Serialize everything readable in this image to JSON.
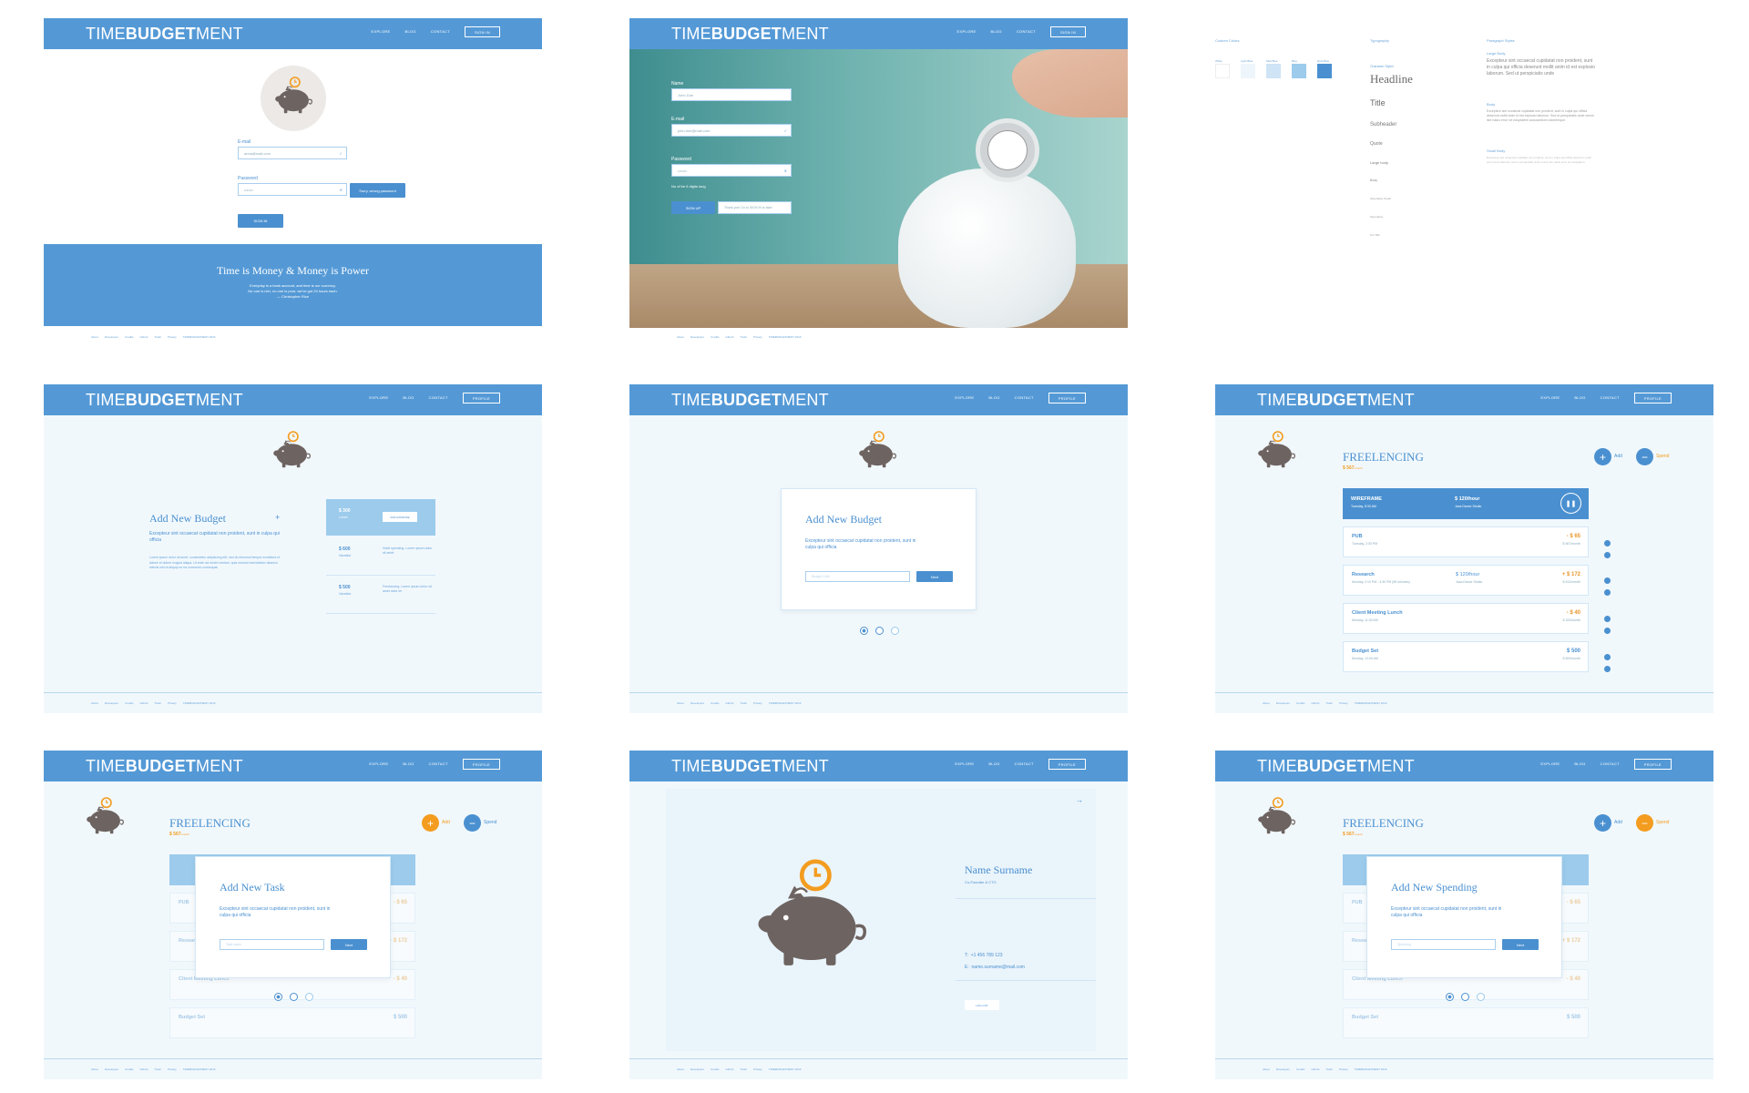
{
  "brand": {
    "pre": "TIME",
    "mid": "BUDGET",
    "post": "MENT"
  },
  "nav": {
    "explore": "EXPLORE",
    "blog": "BLOG",
    "contact": "CONTACT",
    "signin": "SIGN IN",
    "profile": "PROFILE"
  },
  "footer": [
    "About",
    "Developers",
    "Credits",
    "Github",
    "Trash",
    "Privacy",
    "TIMEBUDGETMENT 2016"
  ],
  "s1": {
    "email_label": "E-mail",
    "email_value": "anna@mail.com",
    "password_label": "Password",
    "password_value": "•••••••",
    "error": "Sorry, wrong password",
    "signin": "SIGN IN",
    "quote_title": "Time is Money & Money is Power",
    "quote_body": [
      "Everyday is a bank account, and time is our currency.",
      "No one is rich, no one is poor, we've got 24 hours each.",
      "— Christopher Rice"
    ]
  },
  "s2": {
    "name_label": "Name",
    "name_value": "John Doe",
    "email_label": "E-mail",
    "email_value": "john.doe@mail.com",
    "password_label": "Password",
    "password_value": "•••••••",
    "hint": "No of be 6 digits long",
    "signup": "SIGN UP",
    "thanks": "Thank you! Go to SIGN IN to start"
  },
  "s3": {
    "colors_title": "Custom Colors",
    "swatch_names": [
      "White",
      "Light Blue",
      "Med Blue",
      "Blue",
      "Dark Blue"
    ],
    "swatch_colors": [
      "#ffffff",
      "#eef6fb",
      "#cfe4f5",
      "#9ccbec",
      "#4a90d0"
    ],
    "typo_title": "Typography",
    "char_title": "Character Styles",
    "styles": [
      "Headline",
      "Title",
      "Subheader",
      "Quote",
      "Large body",
      "Body",
      "Secondary Small",
      "Secondary",
      "Sm Title"
    ],
    "para_title": "Paragraph Styles",
    "para_large": "Large Body",
    "para_large_text": "Excepteur sint occaecat cupidatat non proident, sunt in culpa qui officia deserunt mollit anim id est explosio laborum. Sed ut perspiciatis unde",
    "para_body": "Body",
    "para_body_text": "Excepteur sint occaecat cupidatat non proident, sunt in culpa qui officia deserunt mollit anim id est explosio laborum. Sed ut perspiciatis unde omnis iste natus error sit voluptatem accusantium doloremque.",
    "para_small": "Small Body",
    "para_small_text": "Excepteur sint occaecat cupidatat non proident, sunt in culpa qui officia deserunt mollit anim id est laborum sed ut perspiciatis unde omnis iste natus error sit voluptatem."
  },
  "s4": {
    "title": "Add New Budget",
    "plus": "+",
    "sub": "Excepteur sint occaecat cupidatat non proident, sunt in culpa qui officia",
    "body": "Lorem ipsum dolor sit amet, consectetur adipisicing elit, sed do eiusmod tempor incididunt ut labore et dolore magna aliqua. Ut enim ad minim veniam, quis nostrud exercitation ullamco laboris nisi ut aliquip ex ea commodo consequat.",
    "items": [
      {
        "amt": "$ 300",
        "sub": "Lunch",
        "desc": "ADD EXPENSE"
      },
      {
        "amt": "$ 600",
        "sub": "Vacation",
        "desc": "Hotel spending. Lorem ipsum dolor sit amet."
      },
      {
        "amt": "$ 500",
        "sub": "Vacation",
        "desc": "Freelancing. Lorem ipsum dolor sit amet dolor ler"
      }
    ]
  },
  "s5": {
    "title": "Add New Budget",
    "sub": "Excepteur sint occaecat cupidatat non proident, sunt in culpa qui officia",
    "placeholder": "Budget Limit",
    "next": "Next"
  },
  "freel": {
    "title": "FREELENCING",
    "amount": "$ 567",
    "per": "/month",
    "add": "Add",
    "spend": "Spend",
    "plus": "+",
    "minus": "−",
    "active": {
      "name": "WIREFRAME",
      "date": "Tuesday, 8:30 AM",
      "rate": "$ 120/hour",
      "client": "Jaca Dance Studio"
    },
    "rows": [
      {
        "name": "PUB",
        "date": "Tuesday, 2:30 PM",
        "amt": "- $ 65",
        "pm": "$ 567/month"
      },
      {
        "name": "Research",
        "date": "Monday, 2:10 PM - 3:30 PM (80 minutes)",
        "rate": "$ 120/hour",
        "client": "Jaca Dance Studio",
        "amt": "+ $ 172",
        "pm": "$ 512/month"
      },
      {
        "name": "Client Meeting Lunch",
        "date": "Monday, 11:30 AM",
        "amt": "- $ 40",
        "pm": "$ 320/month"
      },
      {
        "name": "Budget Set",
        "date": "Monday, 12:00 AM",
        "amt": "$ 500",
        "pm": "$ 500/month"
      }
    ]
  },
  "s7": {
    "title": "Add New Task",
    "sub": "Excepteur sint occaecat cupidatat non proident, sunt in culpa qui officia",
    "placeholder": "Task name",
    "next": "Next"
  },
  "s8": {
    "name": "Name Surname",
    "role": "Co-Founder & CTO",
    "phone_label": "T:",
    "phone": "+1 456 789 123",
    "email_label": "E:",
    "email": "name.surname@mail.com",
    "logout": "LOG OUT",
    "arrow": "→"
  },
  "s9": {
    "title": "Add New Spending",
    "sub": "Excepteur sint occaecat cupidatat non proident, sunt in culpa qui officia",
    "placeholder": "Spending",
    "next": "Next"
  },
  "colors": {
    "blue": "#5499d6",
    "orange": "#f39c1f",
    "pig": "#6d6360"
  }
}
